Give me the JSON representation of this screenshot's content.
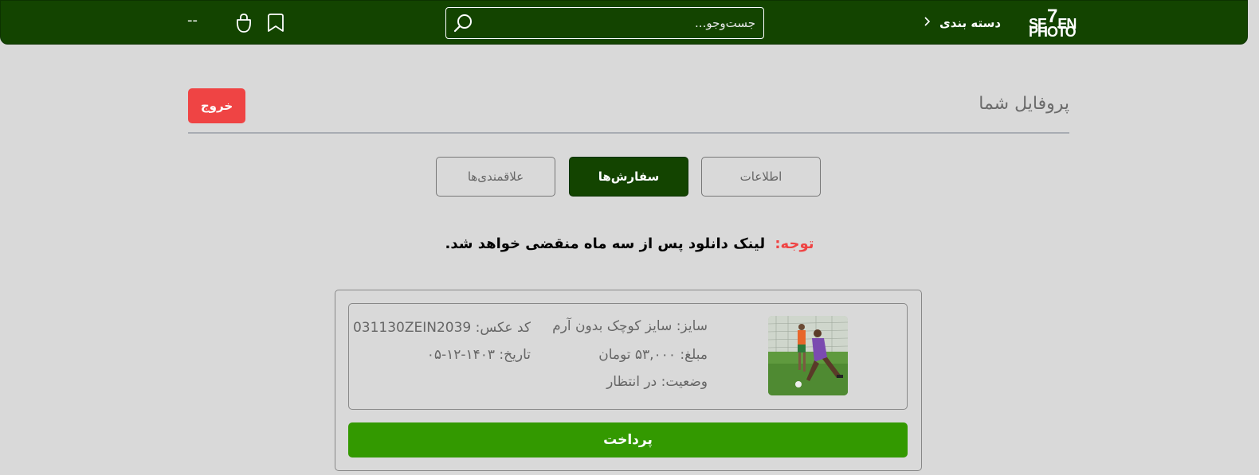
{
  "header": {
    "logo_line1_a": "SE",
    "logo_line1_b": "7",
    "logo_line1_c": "EN",
    "logo_line2": "PHOTO",
    "categories_label": "دسته بندی",
    "search_placeholder": "جست‌وجو...",
    "user_placeholder": "--",
    "icons": [
      "bag-icon",
      "bookmark-icon",
      "search-icon",
      "chevron-right-icon"
    ]
  },
  "profile": {
    "title": "پروفایل شما",
    "logout_label": "خروج"
  },
  "tabs": [
    {
      "label": "اطلاعات",
      "active": false
    },
    {
      "label": "سفارش‌ها",
      "active": true
    },
    {
      "label": "علاقمندی‌ها",
      "active": false
    }
  ],
  "notice": {
    "label": "توجه:",
    "text": "لینک دانلود پس از سه ماه منقضی خواهد شد."
  },
  "order": {
    "size": "سایز: سایز کوچک بدون آرم",
    "price": "مبلغ: ۵۳,۰۰۰ تومان",
    "status": "وضعیت: در انتظار",
    "code": "کد عکس: 031130ZEIN2039",
    "date": "تاریخ: ۱۴۰۳-۱۲-۰۵",
    "pay_label": "پرداخت"
  },
  "colors": {
    "header_bg": "#134400",
    "logout_bg": "#ef4444",
    "pay_bg": "#339900",
    "notice_label": "#ef4444"
  }
}
